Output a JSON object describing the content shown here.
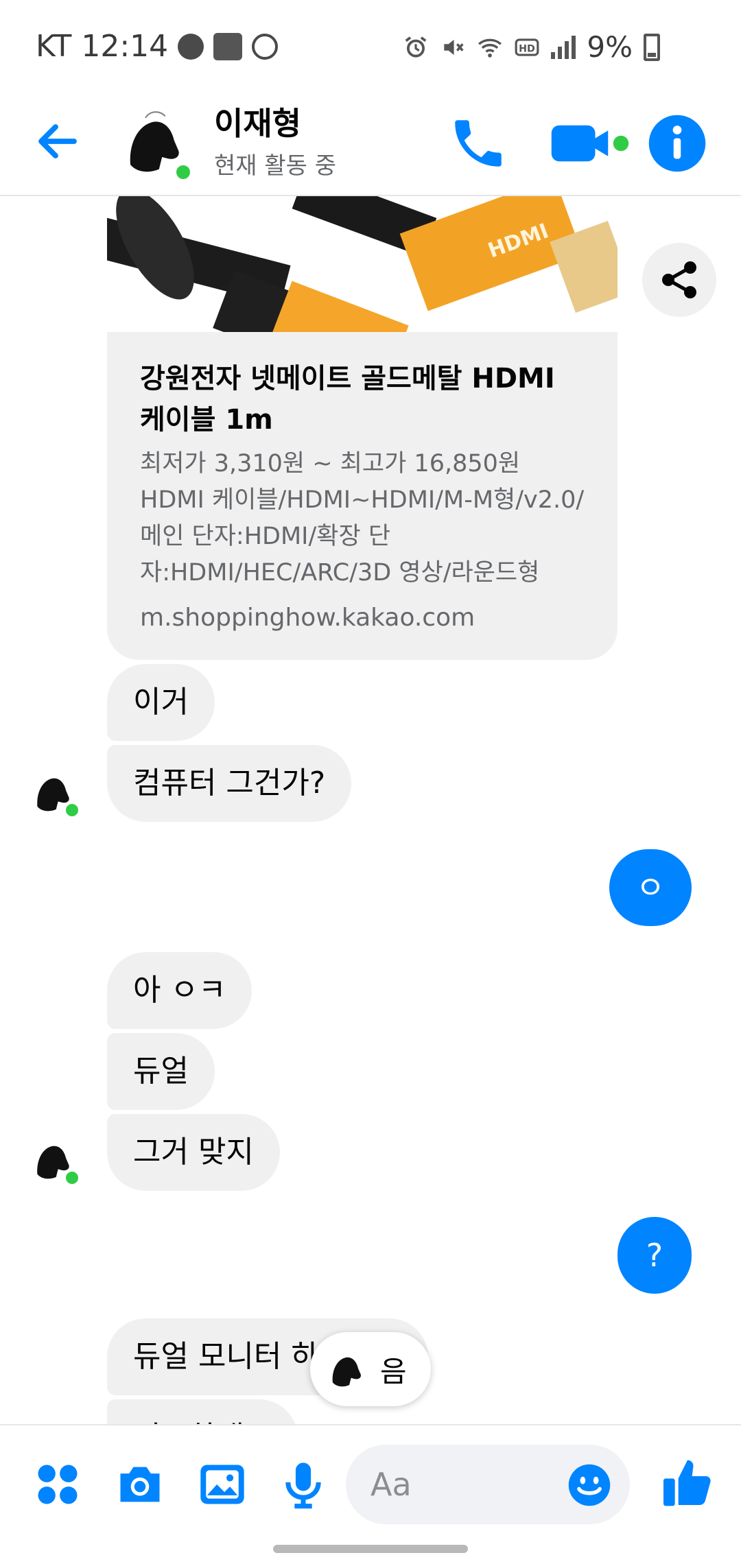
{
  "status_bar": {
    "carrier": "KT",
    "time": "12:14",
    "battery": "9%",
    "left_icons": [
      "facebook-icon",
      "tmoney-icon",
      "messenger-icon"
    ],
    "right_icons": [
      "alarm-icon",
      "mute-icon",
      "wifi-icon",
      "hd-icon",
      "signal-icon",
      "battery-icon"
    ]
  },
  "header": {
    "name": "이재형",
    "status": "현재 활동 중",
    "accent_color": "#0084ff",
    "online_color": "#31cc46"
  },
  "link_card": {
    "title": "강원전자 넷메이트 골드메탈 HDMI 케이블 1m",
    "description": "최저가 3,310원 ~ 최고가 16,850원 HDMI 케이블/HDMI~HDMI/M-M형/v2.0/메인 단자:HDMI/확장 단자:HDMI/HEC/ARC/3D 영상/라운드형",
    "domain": "m.shoppinghow.kakao.com",
    "image_text": "HDMI"
  },
  "messages": [
    {
      "sender": "them",
      "text": "이거"
    },
    {
      "sender": "them",
      "text": "컴퓨터 그건가?"
    },
    {
      "sender": "me",
      "text": "ㅇ"
    },
    {
      "sender": "them",
      "text": "아 ㅇㅋ"
    },
    {
      "sender": "them",
      "text": "듀얼"
    },
    {
      "sender": "them",
      "text": "그거 맞지"
    },
    {
      "sender": "me",
      "text": "?"
    },
    {
      "sender": "them",
      "text": "듀얼 모니터 하려는데"
    },
    {
      "sender": "them",
      "text": "필요하대요"
    }
  ],
  "typing_reaction": {
    "text": "음"
  },
  "composer": {
    "placeholder": "Aa",
    "buttons": [
      "apps-icon",
      "camera-icon",
      "gallery-icon",
      "mic-icon",
      "emoji-icon",
      "like-icon"
    ]
  }
}
